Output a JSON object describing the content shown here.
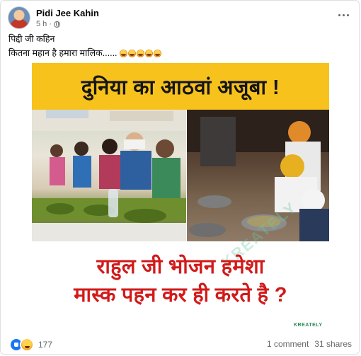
{
  "post": {
    "author": "Pidi Jee Kahin",
    "timestamp": "5 h",
    "audience_icon": "globe-icon",
    "caption_line1": "पिद्दी जी कहिन",
    "caption_line2": "कितना महान है हमारा मालिक......",
    "caption_emojis": [
      "rofl-emoji",
      "rofl-emoji",
      "rofl-emoji",
      "rofl-emoji",
      "rofl-emoji"
    ]
  },
  "image": {
    "headline": "दुनिया का आठवां अजूबा !",
    "bottom_line1": "राहुल जी भोजन हमेशा",
    "bottom_line2": "मास्क पहन कर ही करते है ?",
    "watermark": "KREATELY",
    "brand_mark": "KREATELY",
    "colors": {
      "headline_band": "#f8c21d",
      "bottom_text": "#d11a1a"
    }
  },
  "footer": {
    "reaction_icons": [
      "like-icon",
      "haha-icon"
    ],
    "reaction_count": "177",
    "comments": "1 comment",
    "shares": "31 shares"
  }
}
